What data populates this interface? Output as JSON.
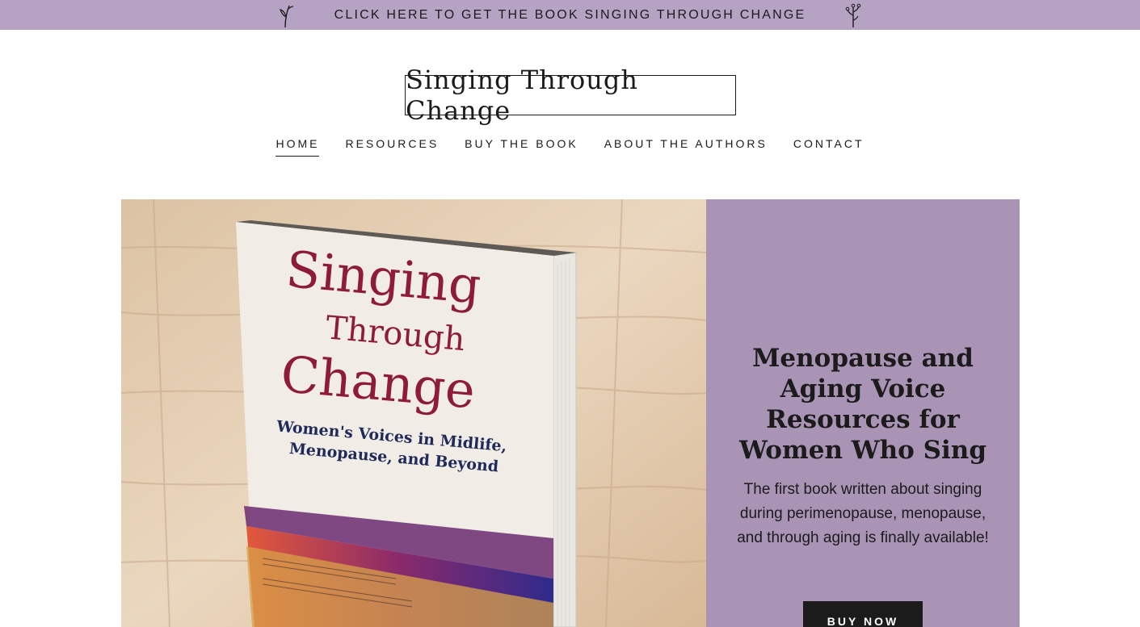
{
  "announcement": {
    "text": "CLICK HERE TO GET THE BOOK SINGING THROUGH CHANGE",
    "left_icon": "sprig-icon",
    "right_icon": "sprig-icon"
  },
  "site": {
    "title": "Singing Through Change"
  },
  "nav": {
    "items": [
      {
        "label": "HOME",
        "active": true
      },
      {
        "label": "RESOURCES",
        "active": false
      },
      {
        "label": "BUY THE BOOK",
        "active": false
      },
      {
        "label": "ABOUT THE AUTHORS",
        "active": false
      },
      {
        "label": "CONTACT",
        "active": false
      }
    ]
  },
  "hero": {
    "book_cover": {
      "title_line1": "Singing",
      "title_line2": "Through",
      "title_line3": "Change",
      "subtitle_line1": "Women's Voices in Midlife,",
      "subtitle_line2": "Menopause, and Beyond"
    },
    "heading": "Menopause and Aging Voice Resources for Women Who Sing",
    "description": "The first book written about singing during perimenopause, menopause, and through aging is finally available!",
    "button_label": "BUY NOW"
  },
  "colors": {
    "announcement_bg": "#b6a3c4",
    "panel_bg": "#a994b6",
    "text": "#1b1b1b",
    "button_bg": "#1b1b1b",
    "book_title": "#8e1b3a"
  }
}
